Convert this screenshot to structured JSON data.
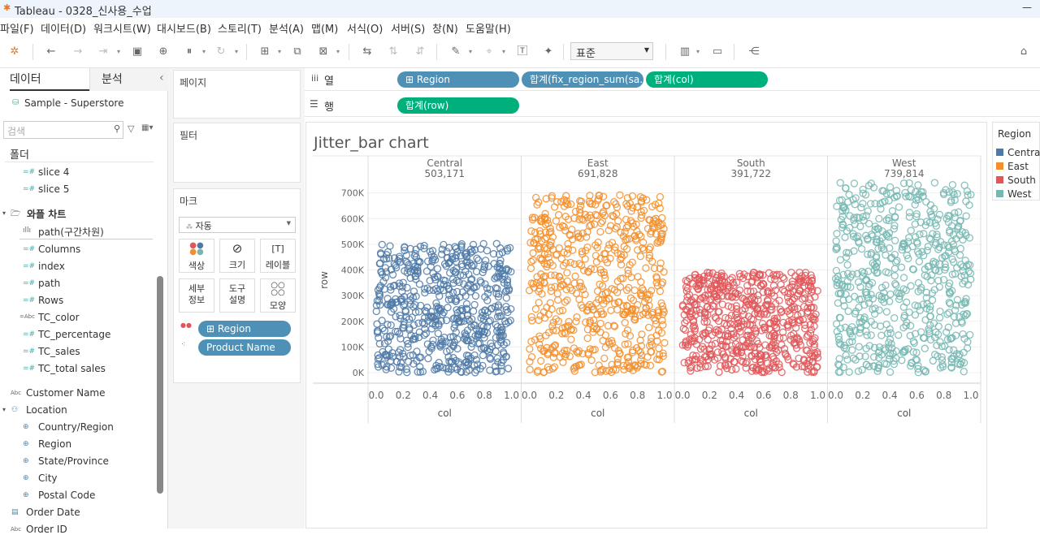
{
  "window": {
    "title": "Tableau - 0328_신사용_수업",
    "minimize": "—"
  },
  "menu": [
    "파일(F)",
    "데이터(D)",
    "워크시트(W)",
    "대시보드(B)",
    "스토리(T)",
    "분석(A)",
    "맵(M)",
    "서식(O)",
    "서버(S)",
    "창(N)",
    "도움말(H)"
  ],
  "toolbar": {
    "fit_label": "표준"
  },
  "datapane": {
    "tab_data": "데이터",
    "tab_analysis": "분석",
    "collapse": "‹",
    "datasource": "Sample - Superstore",
    "search_placeholder": "검색",
    "folder_header": "폴더",
    "fields": [
      {
        "label": "slice 4",
        "icon": "=#"
      },
      {
        "label": "slice 5",
        "icon": "=#"
      },
      {
        "label": "와플 차트",
        "icon": "folder"
      },
      {
        "label": "path(구간차원)",
        "icon": "bars"
      },
      {
        "label": "Columns",
        "icon": "=#"
      },
      {
        "label": "index",
        "icon": "=#"
      },
      {
        "label": "path",
        "icon": "=#"
      },
      {
        "label": "Rows",
        "icon": "=#"
      },
      {
        "label": "TC_color",
        "icon": "Abc"
      },
      {
        "label": "TC_percentage",
        "icon": "=#"
      },
      {
        "label": "TC_sales",
        "icon": "=#"
      },
      {
        "label": "TC_total sales",
        "icon": "=#"
      },
      {
        "label": "Customer Name",
        "icon": "Abc"
      },
      {
        "label": "Location",
        "icon": "hierarchy"
      },
      {
        "label": "Country/Region",
        "icon": "globe"
      },
      {
        "label": "Region",
        "icon": "globe"
      },
      {
        "label": "State/Province",
        "icon": "globe"
      },
      {
        "label": "City",
        "icon": "globe"
      },
      {
        "label": "Postal Code",
        "icon": "globe"
      },
      {
        "label": "Order Date",
        "icon": "calendar"
      },
      {
        "label": "Order ID",
        "icon": "Abc"
      }
    ]
  },
  "cards": {
    "pages": "페이지",
    "filters": "필터",
    "marks": "마크",
    "mark_type": "자동",
    "color": "색상",
    "size": "크기",
    "label": "레이블",
    "detail": "세부\n정보",
    "detail_l1": "세부",
    "detail_l2": "정보",
    "tooltip_l1": "도구",
    "tooltip_l2": "설명",
    "shape": "모양",
    "mark_pills": [
      "⊞ Region",
      "Product Name"
    ]
  },
  "shelves": {
    "columns_label": "열",
    "rows_label": "행",
    "columns_pills": [
      "⊞ Region",
      "합계(fix_region_sum(sa..",
      "합계(col)"
    ],
    "rows_pills": [
      "합계(row)"
    ]
  },
  "chart_data": {
    "type": "scatter",
    "title": "Jitter_bar chart",
    "panels": [
      {
        "region": "Central",
        "total": "503,171",
        "ymax": 503171,
        "color": "#4e79a7"
      },
      {
        "region": "East",
        "total": "691,828",
        "ymax": 691828,
        "color": "#f28e2b"
      },
      {
        "region": "South",
        "total": "391,722",
        "ymax": 391722,
        "color": "#e15759"
      },
      {
        "region": "West",
        "total": "739,814",
        "ymax": 739814,
        "color": "#76b7b2"
      }
    ],
    "xlabel": "col",
    "ylabel": "row",
    "xlim": [
      0,
      1
    ],
    "ylim": [
      0,
      740000
    ],
    "x_ticks": [
      "0.0",
      "0.2",
      "0.4",
      "0.6",
      "0.8",
      "1.0"
    ],
    "y_ticks": [
      "0K",
      "100K",
      "200K",
      "300K",
      "400K",
      "500K",
      "600K",
      "700K"
    ],
    "note": "points = individual products, x = random jitter in [0,1], y = random position in [0, region total]"
  },
  "legend": {
    "title": "Region",
    "items": [
      {
        "label": "Central",
        "color": "#4e79a7"
      },
      {
        "label": "East",
        "color": "#f28e2b"
      },
      {
        "label": "South",
        "color": "#e15759"
      },
      {
        "label": "West",
        "color": "#76b7b2"
      }
    ]
  }
}
